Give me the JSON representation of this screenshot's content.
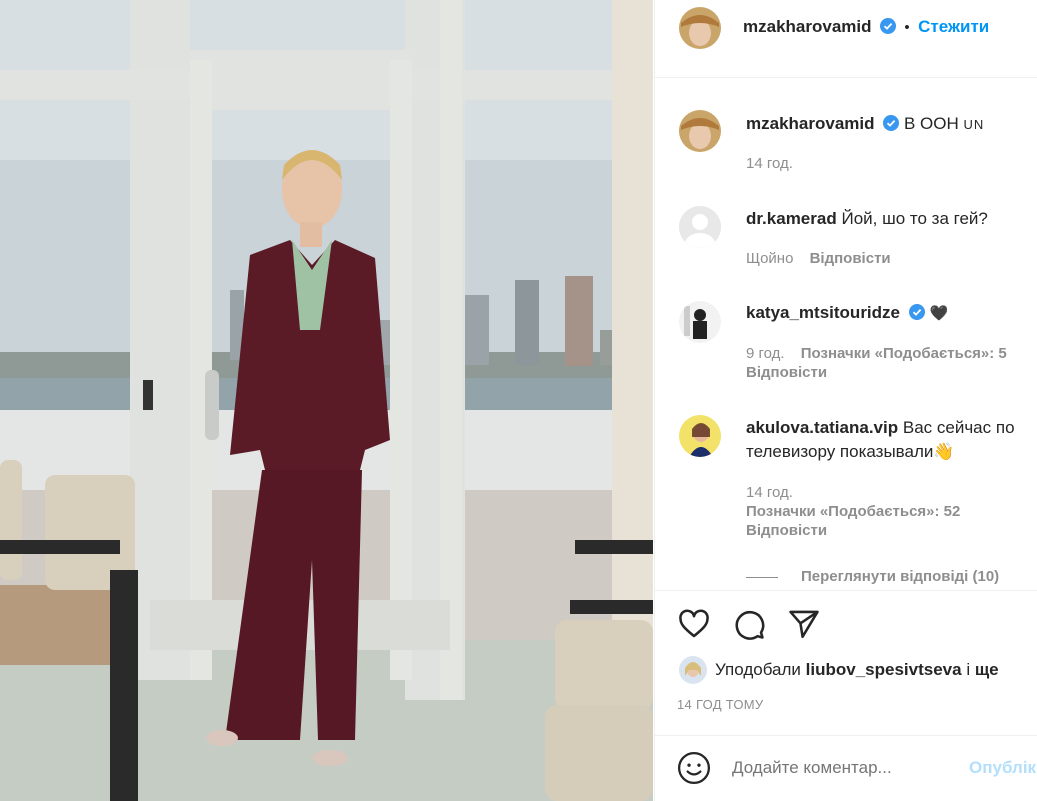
{
  "header": {
    "username": "mzakharovamid",
    "dot": "•",
    "follow_label": "Стежити"
  },
  "caption": {
    "username": "mzakharovamid",
    "text": "В ООН",
    "un_text": "UN",
    "time": "14 год."
  },
  "comments": [
    {
      "username": "dr.kamerad",
      "text": "Йой, шо то за гей?",
      "time": "Щойно",
      "reply_label": "Відповісти"
    },
    {
      "username": "katya_mtsitouridze",
      "text": "🖤",
      "time": "9 год.",
      "likes_label": "Позначки «Подобається»: 5",
      "reply_label": "Відповісти"
    },
    {
      "username": "akulova.tatiana.vip",
      "text": "Вас сейчас по",
      "text_line2": "телевизору показывали👋",
      "time": "14 год.",
      "likes_label": "Позначки «Подобається»: 52",
      "reply_label": "Відповісти",
      "view_replies_label": "Переглянути відповіді (10)"
    }
  ],
  "likes": {
    "prefix": "Уподобали",
    "user": "liubov_spesivtseva",
    "suffix": "і",
    "more": "ще"
  },
  "timestamp": "14 ГОД ТОМУ",
  "comment_box": {
    "placeholder": "Додайте коментар...",
    "post_label": "Опублік"
  },
  "colors": {
    "accent": "#0095f6",
    "verified": "#3897f0",
    "muted": "#8e8e8e",
    "suit": "#5a1a26"
  }
}
